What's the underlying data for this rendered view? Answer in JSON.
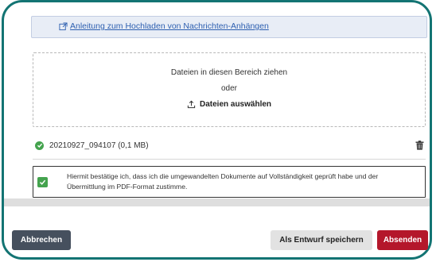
{
  "guide": {
    "link_text": "Anleitung zum Hochladen von Nachrichten-Anhängen",
    "icon": "external-link-icon"
  },
  "dropzone": {
    "title": "Dateien in diesen Bereich ziehen",
    "or_text": "oder",
    "select_label": "Dateien auswählen",
    "icon": "upload-icon"
  },
  "file": {
    "name": "20210927_094107 (0,1 MB)",
    "status_icon": "check-circle-icon",
    "delete_icon": "trash-icon"
  },
  "confirmation": {
    "checked": true,
    "text": "Hiermit bestätige ich, dass ich die umgewandelten Dokumente auf Vollständigkeit geprüft habe und der Übermittlung im PDF-Format zustimme."
  },
  "buttons": {
    "cancel": "Abbrechen",
    "save_draft": "Als Entwurf speichern",
    "send": "Absenden"
  },
  "colors": {
    "frame": "#137473",
    "success": "#44a34e",
    "send_button": "#b4172b",
    "cancel_button": "#46505e",
    "link": "#2d5fb0"
  }
}
